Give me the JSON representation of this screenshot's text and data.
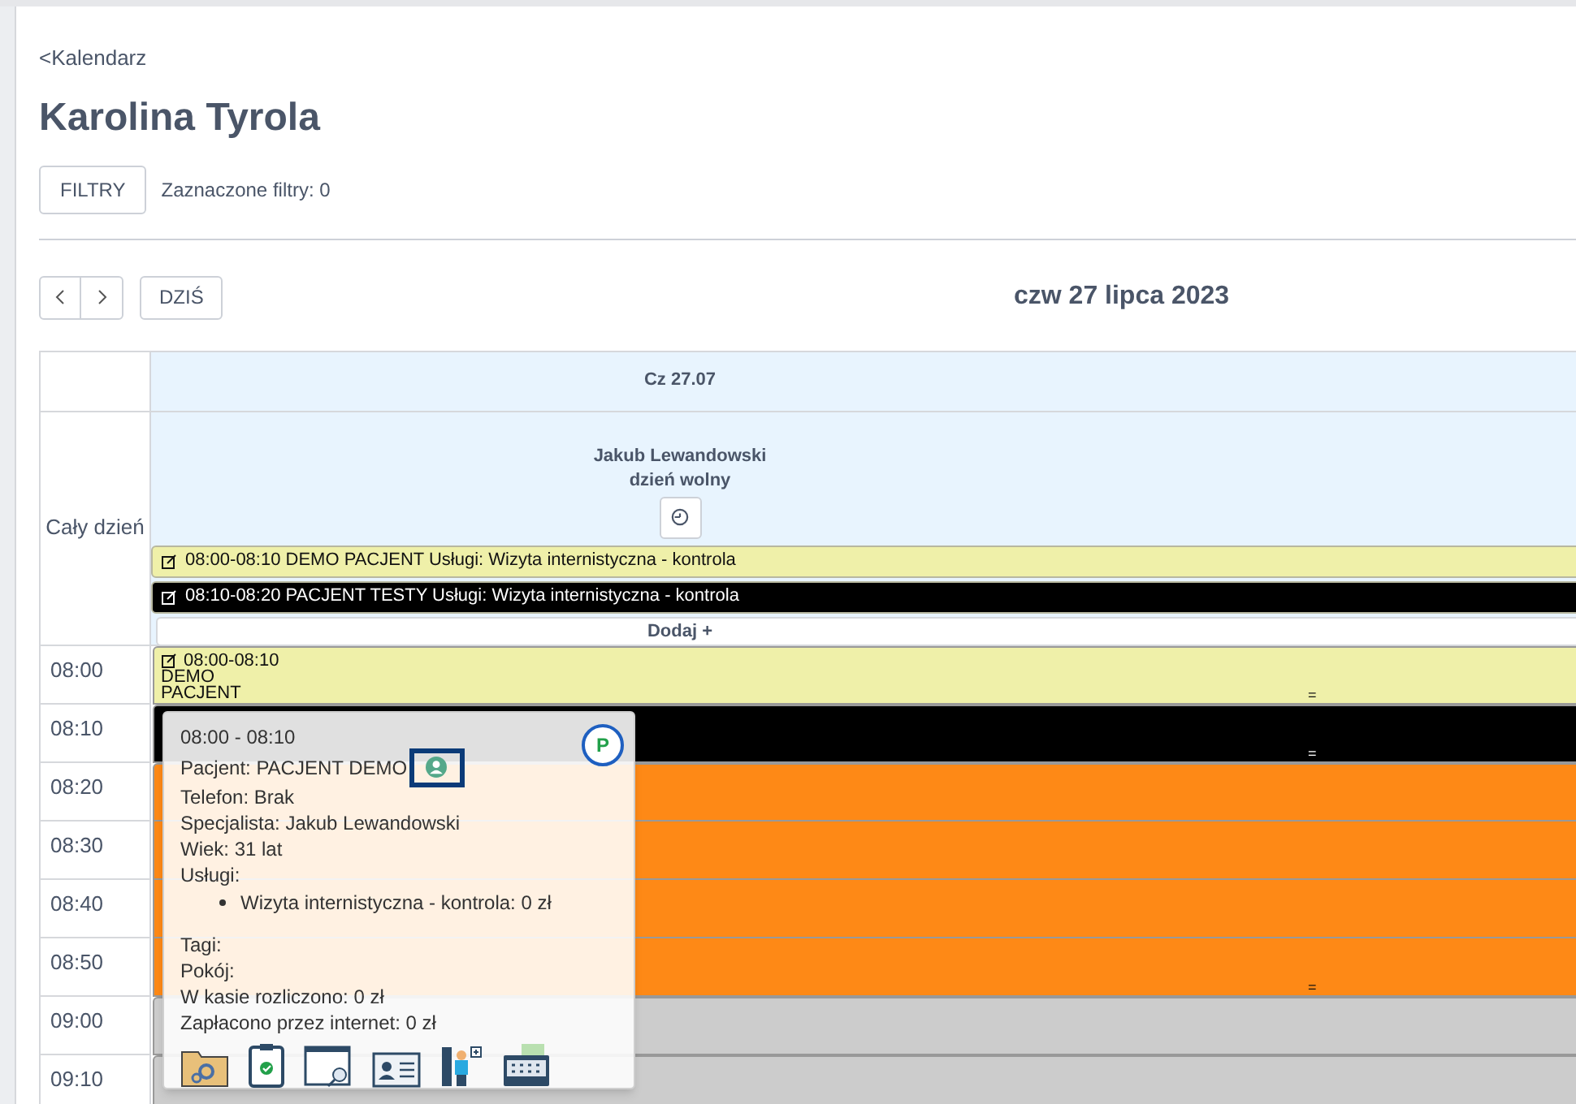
{
  "back_link": "<Kalendarz",
  "title": "Karolina Tyrola",
  "filters": {
    "button": "FILTRY",
    "summary": "Zaznaczone filtry: 0"
  },
  "toolbar": {
    "today": "DZIŚ",
    "date": "czw 27 lipca 2023"
  },
  "calendar": {
    "day_header": "Cz 27.07",
    "all_day_label": "Cały dzień",
    "specialist": {
      "name": "Jakub Lewandowski",
      "status": "dzień wolny"
    },
    "all_day_events": [
      {
        "text": "08:00-08:10 DEMO PACJENT Usługi: Wizyta internistyczna - kontrola",
        "color": "#eff0a9"
      },
      {
        "text": "08:10-08:20 PACJENT TESTY Usługi: Wizyta internistyczna - kontrola",
        "color": "#000000"
      }
    ],
    "add_label": "Dodaj +",
    "slots": [
      {
        "time": "08:00",
        "color": "#eff0a9",
        "continued": false,
        "lines": [
          "08:00-08:10",
          "DEMO",
          "PACJENT"
        ],
        "handle": "="
      },
      {
        "time": "08:10",
        "color": "#000000",
        "continued": false,
        "handle": "="
      },
      {
        "time": "08:20",
        "color": "#fe8916",
        "continued": false
      },
      {
        "time": "08:30",
        "color": "#fe8916",
        "continued": true
      },
      {
        "time": "08:40",
        "color": "#fe8916",
        "continued": true
      },
      {
        "time": "08:50",
        "color": "#fe8916",
        "continued": true,
        "handle": "="
      },
      {
        "time": "09:00",
        "color": "#cccccc",
        "continued": false
      },
      {
        "time": "09:10",
        "color": "#cccccc",
        "continued": false
      }
    ]
  },
  "popup": {
    "time": "08:00 - 08:10",
    "badge": "P",
    "patient": "Pacjent: PACJENT DEMO",
    "details": [
      "Telefon: Brak",
      "Specjalista: Jakub Lewandowski",
      "Wiek: 31 lat",
      "Usługi:"
    ],
    "services": [
      "Wizyta internistyczna - kontrola: 0 zł"
    ],
    "summary": [
      "Tagi:",
      "Pokój:",
      "W kasie rozliczono: 0 zł",
      "Zapłacono przez internet: 0 zł"
    ]
  }
}
